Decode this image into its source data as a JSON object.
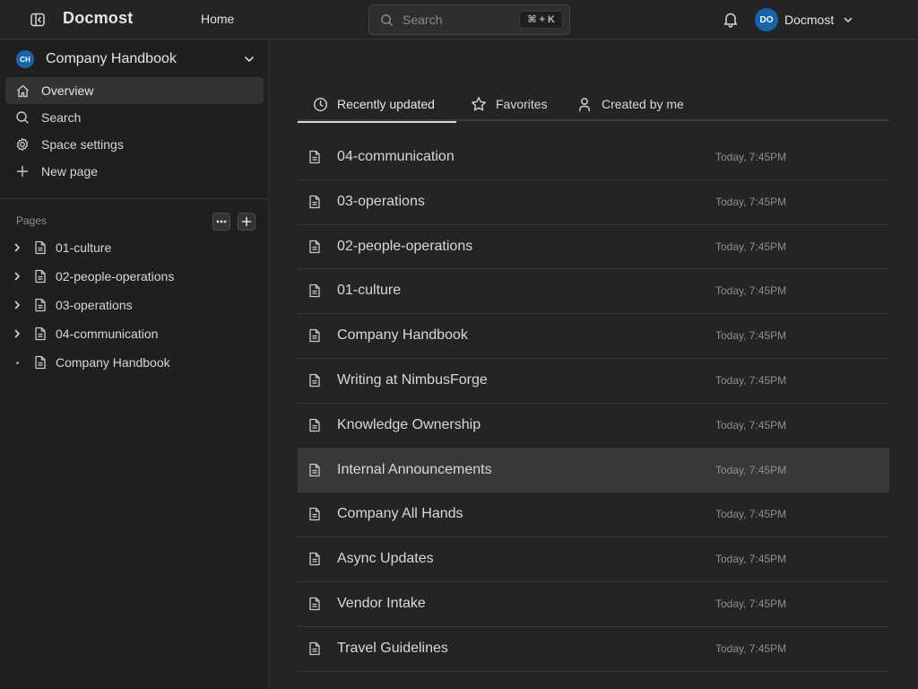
{
  "header": {
    "brand": "Docmost",
    "home_label": "Home",
    "search_placeholder": "Search",
    "search_shortcut": "⌘ + K",
    "user": {
      "initials": "DO",
      "name": "Docmost",
      "avatar_color": "#1864ab"
    }
  },
  "sidebar": {
    "space": {
      "initials": "CH",
      "name": "Company Handbook",
      "avatar_color": "#1864ab"
    },
    "nav": [
      {
        "label": "Overview",
        "icon": "home-icon",
        "active": true
      },
      {
        "label": "Search",
        "icon": "search-icon",
        "active": false
      },
      {
        "label": "Space settings",
        "icon": "gear-icon",
        "active": false
      },
      {
        "label": "New page",
        "icon": "plus-icon",
        "active": false
      }
    ],
    "pages_label": "Pages",
    "tree": [
      {
        "label": "01-culture",
        "has_children": true
      },
      {
        "label": "02-people-operations",
        "has_children": true
      },
      {
        "label": "03-operations",
        "has_children": true
      },
      {
        "label": "04-communication",
        "has_children": true
      },
      {
        "label": "Company Handbook",
        "has_children": false
      }
    ]
  },
  "main": {
    "tabs": [
      {
        "label": "Recently updated",
        "icon": "clock-icon",
        "active": true
      },
      {
        "label": "Favorites",
        "icon": "star-icon",
        "active": false
      },
      {
        "label": "Created by me",
        "icon": "user-icon",
        "active": false
      }
    ],
    "pages": [
      {
        "title": "04-communication",
        "updated": "Today, 7:45PM"
      },
      {
        "title": "03-operations",
        "updated": "Today, 7:45PM"
      },
      {
        "title": "02-people-operations",
        "updated": "Today, 7:45PM"
      },
      {
        "title": "01-culture",
        "updated": "Today, 7:45PM"
      },
      {
        "title": "Company Handbook",
        "updated": "Today, 7:45PM"
      },
      {
        "title": "Writing at NimbusForge",
        "updated": "Today, 7:45PM"
      },
      {
        "title": "Knowledge Ownership",
        "updated": "Today, 7:45PM"
      },
      {
        "title": "Internal Announcements",
        "updated": "Today, 7:45PM",
        "hovered": true
      },
      {
        "title": "Company All Hands",
        "updated": "Today, 7:45PM"
      },
      {
        "title": "Async Updates",
        "updated": "Today, 7:45PM"
      },
      {
        "title": "Vendor Intake",
        "updated": "Today, 7:45PM"
      },
      {
        "title": "Travel Guidelines",
        "updated": "Today, 7:45PM"
      }
    ]
  }
}
